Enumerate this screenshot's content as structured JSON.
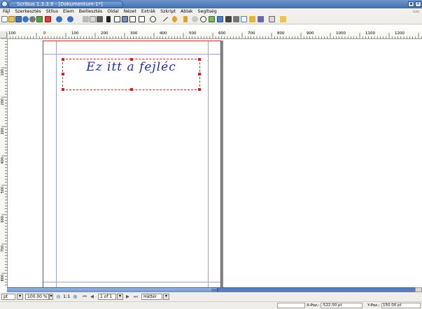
{
  "window": {
    "title": "Scribus 1.3.3.9 - [Dokumentum-1*]",
    "minimize_glyph": "▪",
    "close_glyph": "✕"
  },
  "menu": {
    "items": [
      "Fájl",
      "Szerkesztés",
      "Stílus",
      "Elem",
      "Beillesztés",
      "Oldal",
      "Nézet",
      "Extrák",
      "Szkript",
      "Ablak",
      "Segítség"
    ],
    "right_glyph": "▭▭"
  },
  "toolbar": {
    "icons": [
      "new-icon",
      "open-icon",
      "save-icon",
      "close-doc-icon",
      "print-icon",
      "preflight-icon",
      "pdf-icon",
      "undo-icon",
      "redo-icon",
      "cut-icon",
      "copy-icon",
      "paste-icon",
      "select-icon",
      "text-frame-icon",
      "image-frame-icon",
      "table-icon",
      "shape-icon",
      "polygon-icon",
      "line-icon",
      "bezier-icon",
      "freehand-icon",
      "rotate-icon",
      "zoom-icon",
      "edit-contents-icon",
      "edit-text-icon",
      "link-frames-icon",
      "unlink-frames-icon",
      "measure-icon",
      "copy-properties-icon",
      "eyedropper-icon",
      "pdf-tools-icon",
      "pdf-annotations-icon"
    ]
  },
  "ruler": {
    "h_labels": [
      "100",
      "0",
      "100",
      "200",
      "300",
      "400",
      "500",
      "600",
      "700",
      "800",
      "900",
      "1000",
      "1100",
      "1200"
    ],
    "v_labels": [
      "100",
      "200",
      "300",
      "400",
      "500",
      "600",
      "700",
      "800"
    ]
  },
  "document": {
    "text_frame_content": "Ez itt a fejléc"
  },
  "bottom": {
    "unit": "pt",
    "zoom": "100.00 %",
    "zoom_ratio": "1:1",
    "page": "1 of 1",
    "layer": "Háttér",
    "first_glyph": "⏮",
    "prev_glyph": "◀",
    "next_glyph": "▶",
    "last_glyph": "⏭",
    "drop_glyph": "▾"
  },
  "status": {
    "x_label": "X-Poz.:",
    "x_value": "-522.00 pt",
    "y_label": "Y-Poz.:",
    "y_value": "150.00 pt"
  }
}
